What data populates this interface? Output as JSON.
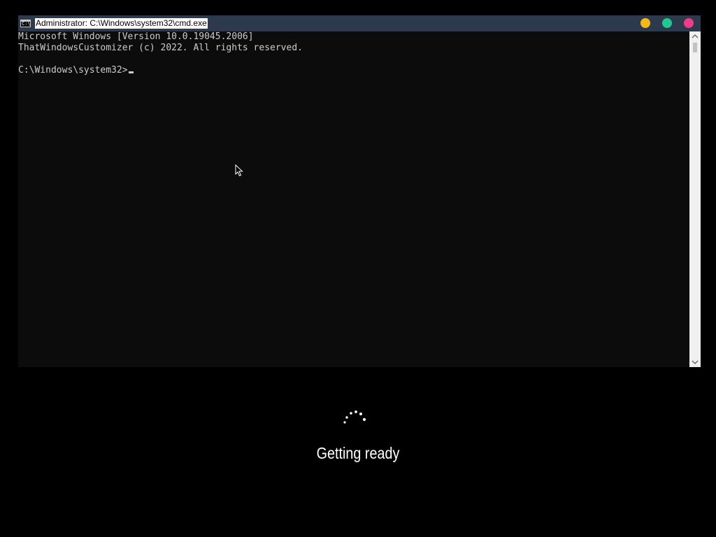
{
  "window": {
    "title": "Administrator: C:\\Windows\\system32\\cmd.exe",
    "icon": "cmd-app-icon",
    "icon_glyph": "C:\\",
    "controls": {
      "minimize_color": "#f5b917",
      "maximize_color": "#1fc890",
      "close_color": "#f03c87"
    }
  },
  "console": {
    "lines": [
      "Microsoft Windows [Version 10.0.19045.2006]",
      "ThatWindowsCustomizer (c) 2022. All rights reserved.",
      "",
      "C:\\Windows\\system32>"
    ],
    "background": "#0c0c0c",
    "text_color": "#cccccc"
  },
  "scrollbar": {
    "up_icon": "scroll-up-arrow-icon",
    "down_icon": "scroll-down-arrow-icon"
  },
  "setup": {
    "status": "Getting ready",
    "spinner_icon": "loading-dots-icon"
  }
}
